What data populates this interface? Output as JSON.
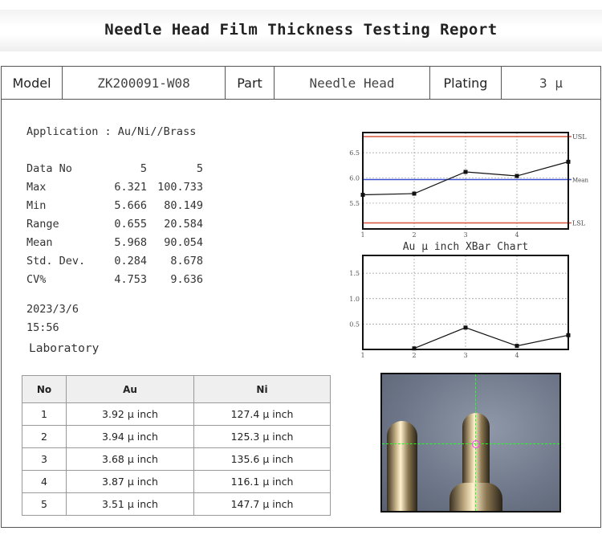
{
  "title": "Needle Head Film Thickness Testing Report",
  "header": {
    "model_label": "Model",
    "model_value": "ZK200091-W08",
    "part_label": "Part",
    "part_value": "Needle Head",
    "plating_label": "Plating",
    "plating_value": "3 μ"
  },
  "application": "Application : Au/Ni//Brass",
  "stats": [
    {
      "label": "Data No",
      "au": "5",
      "ni": "5"
    },
    {
      "label": "Max",
      "au": "6.321",
      "ni": "100.733"
    },
    {
      "label": "Min",
      "au": "5.666",
      "ni": "80.149"
    },
    {
      "label": "Range",
      "au": "0.655",
      "ni": "20.584"
    },
    {
      "label": "Mean",
      "au": "5.968",
      "ni": "90.054"
    },
    {
      "label": "Std. Dev.",
      "au": "0.284",
      "ni": "8.678"
    },
    {
      "label": "CV%",
      "au": "4.753",
      "ni": "9.636"
    }
  ],
  "date": "2023/3/6",
  "time": "15:56",
  "lab": "Laboratory",
  "table": {
    "headers": [
      "No",
      "Au",
      "Ni"
    ],
    "rows": [
      [
        "1",
        "3.92 μ inch",
        "127.4 μ inch"
      ],
      [
        "2",
        "3.94 μ inch",
        "125.3 μ inch"
      ],
      [
        "3",
        "3.68 μ inch",
        "135.6 μ inch"
      ],
      [
        "4",
        "3.87 μ inch",
        "116.1 μ inch"
      ],
      [
        "5",
        "3.51 μ inch",
        "147.7 μ inch"
      ]
    ]
  },
  "chart_data": [
    {
      "type": "line",
      "title": "Au μ inch  XBar Chart",
      "x": [
        1,
        2,
        3,
        4,
        5
      ],
      "values": [
        5.666,
        5.69,
        6.12,
        6.04,
        6.321
      ],
      "ylim": [
        4.99,
        6.9
      ],
      "yticks": [
        "5.5",
        "6.0",
        "6.5"
      ],
      "xticks": [
        "1",
        "2",
        "3",
        "4"
      ],
      "usl": 6.82,
      "lsl": 5.11,
      "mean": 5.968,
      "labels": {
        "usl": "USL",
        "lsl": "LSL",
        "mean": "Mean"
      },
      "colors": {
        "limits": "#d9553a",
        "mean": "#3b4fd0"
      }
    },
    {
      "type": "line",
      "x": [
        2,
        3,
        4,
        5
      ],
      "values": [
        0.02,
        0.43,
        0.07,
        0.28
      ],
      "ylim": [
        0,
        1.85
      ],
      "yticks": [
        "0.5",
        "1.0",
        "1.5"
      ],
      "xticks": [
        "1",
        "2",
        "3",
        "4"
      ]
    }
  ]
}
